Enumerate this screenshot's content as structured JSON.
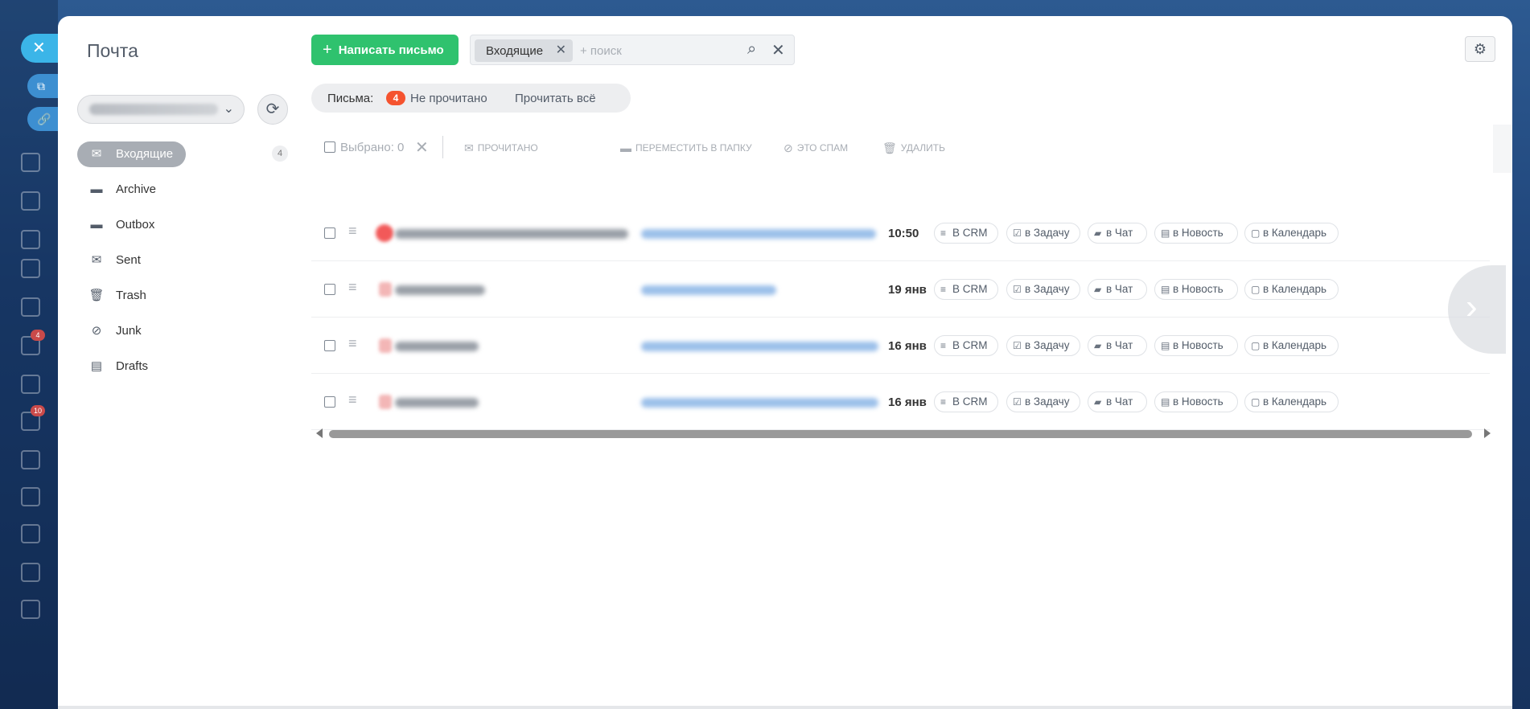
{
  "background": {
    "badges": [
      "4",
      "10"
    ]
  },
  "sidebar": {
    "title": "Почта",
    "folders": [
      {
        "label": "Входящие",
        "icon": "envelope-icon",
        "count": "4",
        "active": true
      },
      {
        "label": "Archive",
        "icon": "folder-icon"
      },
      {
        "label": "Outbox",
        "icon": "folder-icon"
      },
      {
        "label": "Sent",
        "icon": "sent-icon"
      },
      {
        "label": "Trash",
        "icon": "trash-icon"
      },
      {
        "label": "Junk",
        "icon": "block-icon"
      },
      {
        "label": "Drafts",
        "icon": "draft-icon"
      }
    ]
  },
  "toolbar": {
    "compose_label": "Написать письмо",
    "search_chip": "Входящие",
    "search_placeholder": "+ поиск"
  },
  "filter": {
    "label": "Письма:",
    "unread_count": "4",
    "unread_label": "Не прочитано",
    "read_all": "Прочитать всё"
  },
  "bulk": {
    "selected": "Выбрано: 0",
    "actions": [
      "Прочитано",
      "Переместить в папку",
      "Это спам",
      "Удалить"
    ]
  },
  "messages": [
    {
      "time": "10:50"
    },
    {
      "time": "19 янв"
    },
    {
      "time": "16 янв"
    },
    {
      "time": "16 янв"
    }
  ],
  "row_actions": [
    "В CRM",
    "в Задачу",
    "в Чат",
    "в Новость",
    "в Календарь"
  ],
  "colors": {
    "accent_green": "#2fc26e",
    "badge_red": "#f5532f",
    "active_folder": "#a8adb4"
  }
}
